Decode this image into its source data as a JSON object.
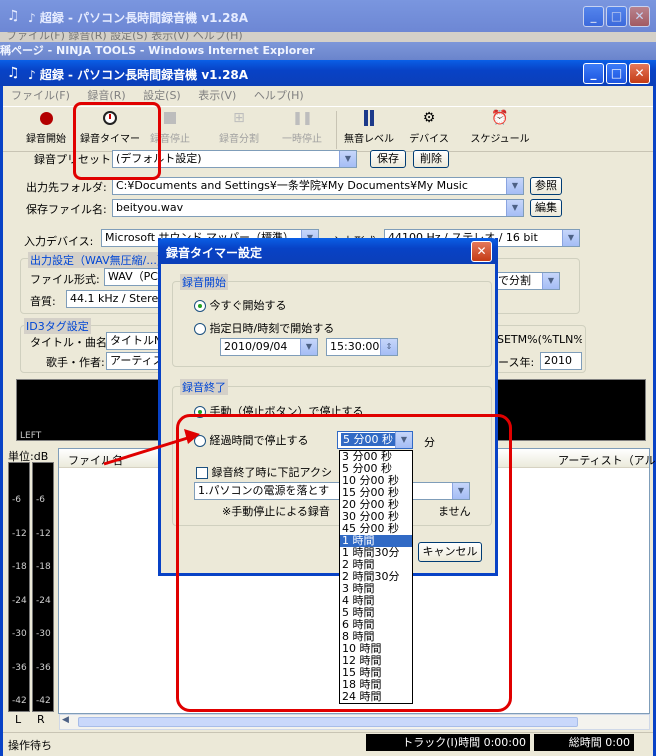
{
  "back_window": {
    "title": "♪ 超録 - パソコン長時間録音機 v1.28A",
    "menu_fragment": "ファイル(F)  録音(R)  設定(S)  表示(V)  ヘルプ(H)"
  },
  "ie_window": {
    "title": "稱ページ - NINJA TOOLS - Windows Internet Explorer"
  },
  "app": {
    "title": "♪ 超録 - パソコン長時間録音機 v1.28A",
    "menu": [
      "ファイル(F)",
      "録音(R)",
      "設定(S)",
      "表示(V)",
      "ヘルプ(H)"
    ],
    "toolbar": [
      {
        "label": "録音開始",
        "icon": "record-icon",
        "enabled": true
      },
      {
        "label": "録音タイマー",
        "icon": "clock-icon",
        "enabled": true
      },
      {
        "label": "録音停止",
        "icon": "stop-icon",
        "enabled": false
      },
      {
        "label": "録音分割",
        "icon": "split-icon",
        "enabled": false
      },
      {
        "label": "一時停止",
        "icon": "pause-icon",
        "enabled": false
      },
      {
        "label": "無音レベル",
        "icon": "level-icon",
        "enabled": true
      },
      {
        "label": "デバイス",
        "icon": "device-icon",
        "enabled": true
      },
      {
        "label": "スケジュール",
        "icon": "schedule-icon",
        "enabled": true
      }
    ],
    "preset_label": "録音プリセット:",
    "preset_value": "(デフォルト設定)",
    "save_button": "保存",
    "delete_button": "削除",
    "output_folder_label": "出力先フォルダ:",
    "output_folder_value": "C:¥Documents and Settings¥一条学院¥My Documents¥My Music",
    "reference_button": "参照",
    "save_file_label": "保存ファイル名:",
    "save_file_value": "beityou.wav",
    "edit_button": "編集",
    "input_device_label": "入力デバイス:",
    "input_device_value": "Microsoft サウンド マッパー（標準）",
    "input_format_label": "入力形式:",
    "input_format_value": "44100 Hz / ステレオ / 16 bit",
    "output_settings_title": "出力設定（WAV無圧縮/...）",
    "file_format_label": "ファイル形式:",
    "file_format_value": "WAV（PCM）",
    "split_value": "で分割",
    "quality_label": "音質:",
    "quality_value": "44.1 kHz / Stereo",
    "id3_title": "ID3タグ設定",
    "title_label": "タイトル・曲名:",
    "title_value": "タイトルNo",
    "title_tail": "SETM%(%TLN%)",
    "artist_label": "歌手・作者:",
    "artist_value": "アーティスト",
    "year_label": "ース年:",
    "year_value": "2010",
    "left_label": "LEFT",
    "unit_label": "単位:dB",
    "db_ticks": [
      "-6",
      "-12",
      "-18",
      "-24",
      "-30",
      "-36",
      "-42"
    ],
    "lr_labels": [
      "L",
      "R"
    ],
    "col_file": "ファイル名",
    "col_artist": "アーティスト（アルバ",
    "status_left": "操作待ち",
    "status_track": "トラック(I)時間 0:00:00",
    "status_total": "総時間 0:00"
  },
  "dialog": {
    "title": "録音タイマー設定",
    "start_group": "録音開始",
    "start_now": "今すぐ開始する",
    "start_at": "指定日時/時刻で開始する",
    "date": "2010/09/04",
    "time": "15:30:00",
    "end_group": "録音終了",
    "manual_stop": "手動（停止ボタン）で停止する",
    "elapsed_stop": "経過時間で停止する",
    "elapsed_value": "5 分00 秒",
    "minute_unit": "分",
    "action_check": "録音終了時に下記アクシ",
    "action_value": "1.パソコンの電源を落とす",
    "note": "※手動停止による録音",
    "note_tail": "ません",
    "cancel_button": "キャンセル",
    "options": [
      "3 分00 秒",
      "5 分00 秒",
      "10 分00 秒",
      "15 分00 秒",
      "20 分00 秒",
      "30 分00 秒",
      "45 分00 秒",
      "1 時間",
      "1 時間30分",
      "2 時間",
      "2 時間30分",
      "3 時間",
      "4 時間",
      "5 時間",
      "6 時間",
      "8 時間",
      "10 時間",
      "12 時間",
      "15 時間",
      "18 時間",
      "24 時間"
    ],
    "selected_index": 7
  },
  "colors": {
    "annotation_red": "#e00000",
    "xp_blue": "#0a5fe6",
    "selection": "#316ac5"
  }
}
